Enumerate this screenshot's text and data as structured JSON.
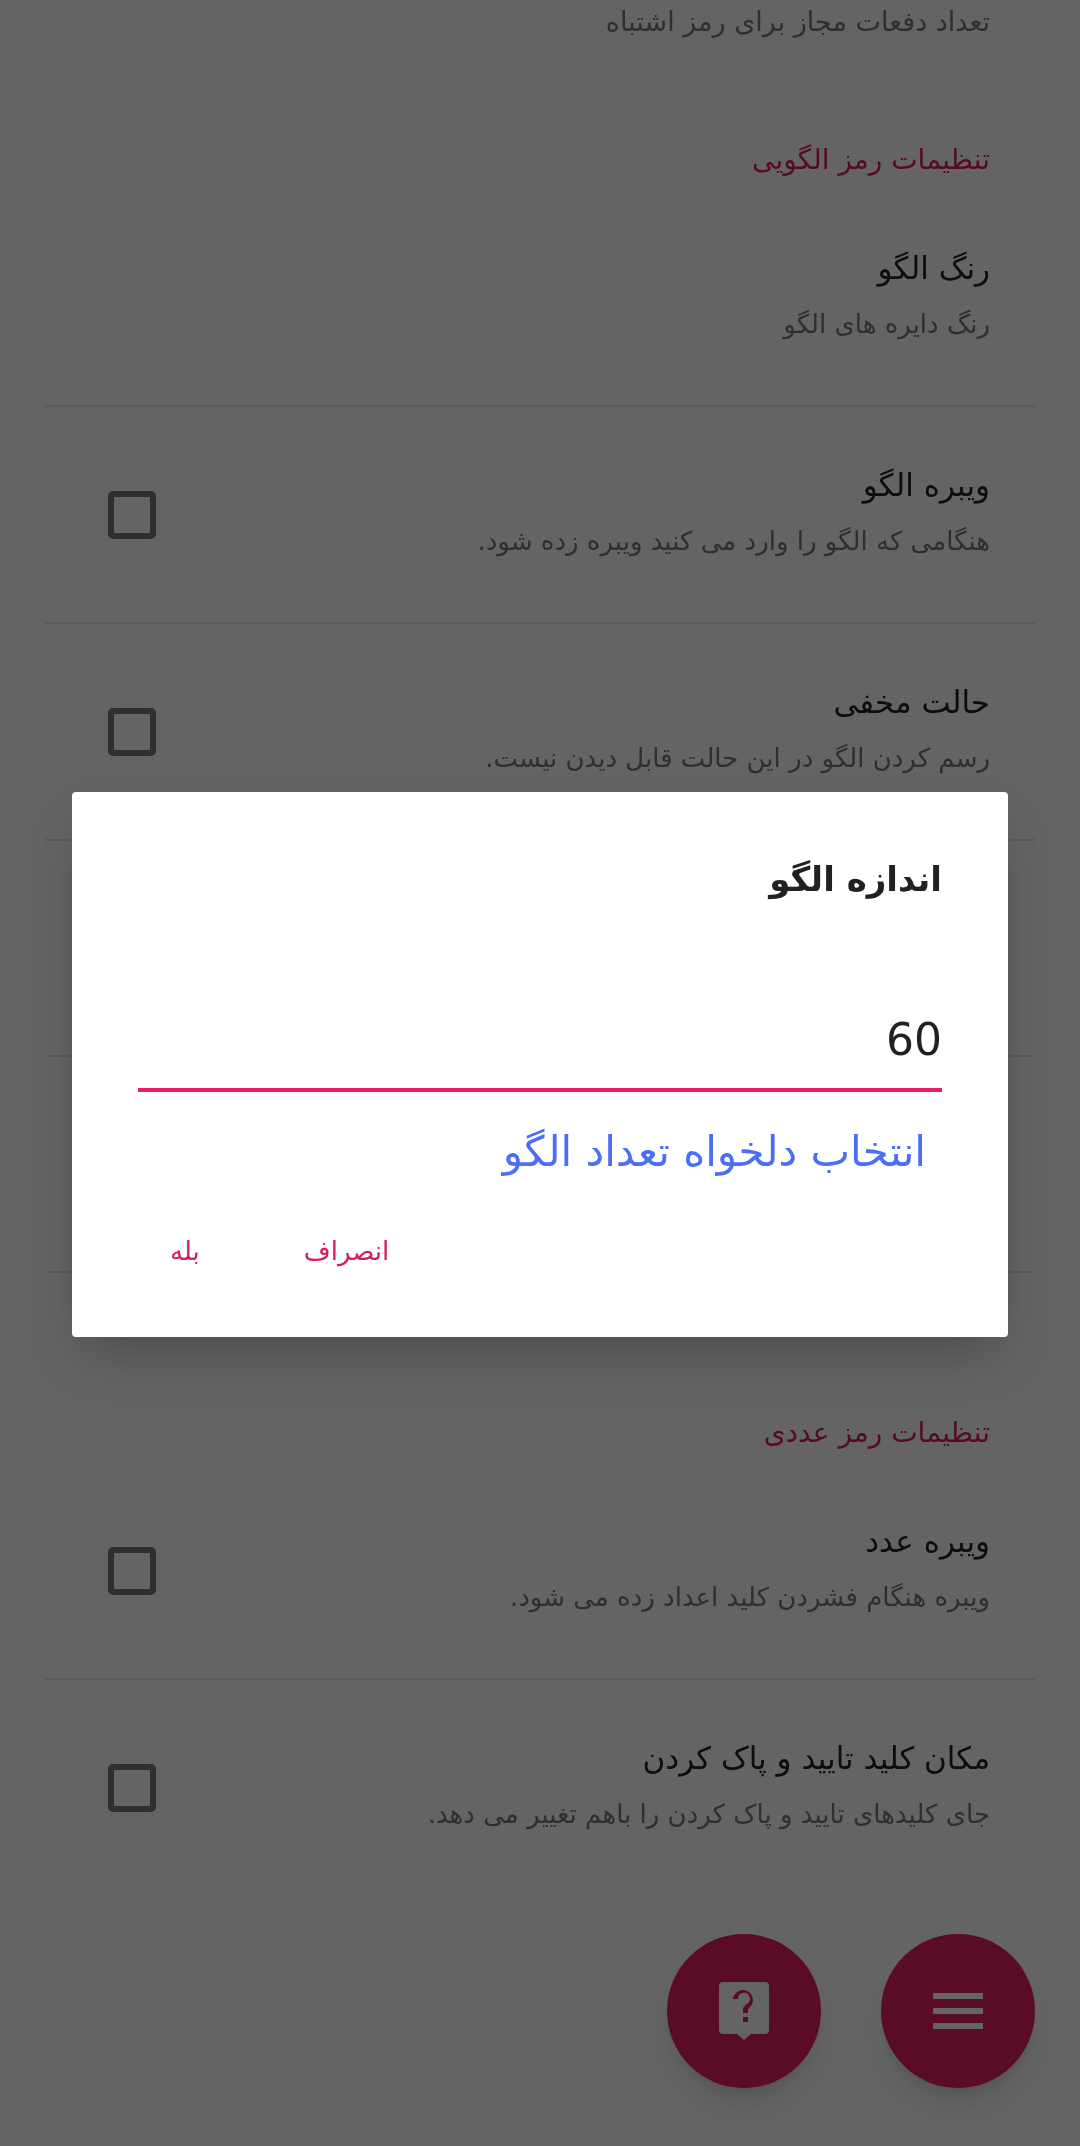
{
  "cut_subtitle": "تعداد دفعات مجاز برای رمز اشتباه",
  "sections": [
    {
      "header": "تنظیمات رمز الگویی",
      "items": [
        {
          "kind": "plain",
          "title": "رنگ الگو",
          "subtitle": "رنگ دایره های الگو"
        },
        {
          "kind": "checkbox",
          "title": "ویبره الگو",
          "subtitle": "هنگامی که الگو را وارد می کنید ویبره زده شود.",
          "checked": false
        },
        {
          "kind": "checkbox",
          "title": "حالت مخفی",
          "subtitle": "رسم کردن الگو در این حالت قابل دیدن نیست.",
          "checked": false
        }
      ]
    },
    {
      "header": "تنظیمات رمز عددی",
      "items": [
        {
          "kind": "checkbox",
          "title": "ویبره عدد",
          "subtitle": "ویبره هنگام فشردن کلید اعداد زده می شود.",
          "checked": false
        },
        {
          "kind": "checkbox",
          "title": "مکان کلید تایید و پاک کردن",
          "subtitle": "جای کلیدهای تایید و پاک کردن را باهم تغییر می دهد.",
          "checked": false
        }
      ]
    }
  ],
  "dialog": {
    "title": "اندازه الگو",
    "value": "60",
    "helper": "انتخاب دلخواه تعداد الگو",
    "buttons": [
      "انصراف",
      "بله"
    ]
  }
}
